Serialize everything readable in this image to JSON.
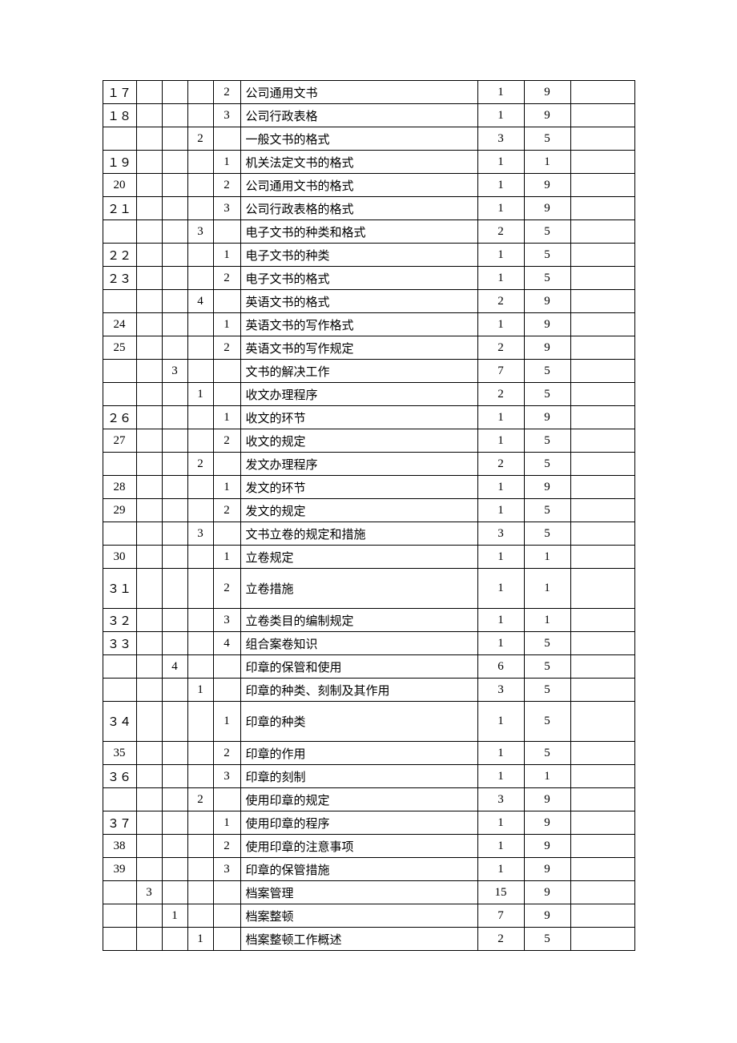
{
  "chart_data": {
    "type": "table",
    "rows": [
      {
        "c0": "１７",
        "c1": "",
        "c2": "",
        "c3": "",
        "c4": "2",
        "c5": "公司通用文书",
        "c6": "1",
        "c7": "9",
        "c8": ""
      },
      {
        "c0": "１８",
        "c1": "",
        "c2": "",
        "c3": "",
        "c4": "3",
        "c5": "公司行政表格",
        "c6": "1",
        "c7": "9",
        "c8": ""
      },
      {
        "c0": "",
        "c1": "",
        "c2": "",
        "c3": "2",
        "c4": "",
        "c5": "一般文书的格式",
        "c6": "3",
        "c7": "5",
        "c8": ""
      },
      {
        "c0": "１９",
        "c1": "",
        "c2": "",
        "c3": "",
        "c4": "1",
        "c5": "机关法定文书的格式",
        "c6": "1",
        "c7": "1",
        "c8": ""
      },
      {
        "c0": "20",
        "c1": "",
        "c2": "",
        "c3": "",
        "c4": "2",
        "c5": "公司通用文书的格式",
        "c6": "1",
        "c7": "9",
        "c8": ""
      },
      {
        "c0": "２１",
        "c1": "",
        "c2": "",
        "c3": "",
        "c4": "3",
        "c5": "公司行政表格的格式",
        "c6": "1",
        "c7": "9",
        "c8": ""
      },
      {
        "c0": "",
        "c1": "",
        "c2": "",
        "c3": "3",
        "c4": "",
        "c5": "电子文书的种类和格式",
        "c6": "2",
        "c7": "5",
        "c8": ""
      },
      {
        "c0": "２２",
        "c1": "",
        "c2": "",
        "c3": "",
        "c4": "1",
        "c5": "电子文书的种类",
        "c6": "1",
        "c7": "5",
        "c8": ""
      },
      {
        "c0": "２３",
        "c1": "",
        "c2": "",
        "c3": "",
        "c4": "2",
        "c5": "电子文书的格式",
        "c6": "1",
        "c7": "5",
        "c8": ""
      },
      {
        "c0": "",
        "c1": "",
        "c2": "",
        "c3": "4",
        "c4": "",
        "c5": "英语文书的格式",
        "c6": "2",
        "c7": "9",
        "c8": ""
      },
      {
        "c0": "24",
        "c1": "",
        "c2": "",
        "c3": "",
        "c4": "1",
        "c5": "英语文书的写作格式",
        "c6": "1",
        "c7": "9",
        "c8": ""
      },
      {
        "c0": "25",
        "c1": "",
        "c2": "",
        "c3": "",
        "c4": "2",
        "c5": "英语文书的写作规定",
        "c6": "2",
        "c7": "9",
        "c8": ""
      },
      {
        "c0": "",
        "c1": "",
        "c2": "3",
        "c3": "",
        "c4": "",
        "c5": "文书的解决工作",
        "c6": "7",
        "c7": "5",
        "c8": ""
      },
      {
        "c0": "",
        "c1": "",
        "c2": "",
        "c3": "1",
        "c4": "",
        "c5": "收文办理程序",
        "c6": "2",
        "c7": "5",
        "c8": ""
      },
      {
        "c0": "２６",
        "c1": "",
        "c2": "",
        "c3": "",
        "c4": "1",
        "c5": "收文的环节",
        "c6": "1",
        "c7": "9",
        "c8": ""
      },
      {
        "c0": "27",
        "c1": "",
        "c2": "",
        "c3": "",
        "c4": "2",
        "c5": "收文的规定",
        "c6": "1",
        "c7": "5",
        "c8": ""
      },
      {
        "c0": "",
        "c1": "",
        "c2": "",
        "c3": "2",
        "c4": "",
        "c5": "发文办理程序",
        "c6": "2",
        "c7": "5",
        "c8": ""
      },
      {
        "c0": "28",
        "c1": "",
        "c2": "",
        "c3": "",
        "c4": "1",
        "c5": "发文的环节",
        "c6": "1",
        "c7": "9",
        "c8": ""
      },
      {
        "c0": "29",
        "c1": "",
        "c2": "",
        "c3": "",
        "c4": "2",
        "c5": "发文的规定",
        "c6": "1",
        "c7": "5",
        "c8": ""
      },
      {
        "c0": "",
        "c1": "",
        "c2": "",
        "c3": "3",
        "c4": "",
        "c5": "文书立卷的规定和措施",
        "c6": "3",
        "c7": "5",
        "c8": ""
      },
      {
        "c0": "30",
        "c1": "",
        "c2": "",
        "c3": "",
        "c4": "1",
        "c5": "立卷规定",
        "c6": "1",
        "c7": "1",
        "c8": ""
      },
      {
        "c0": "３１",
        "c1": "",
        "c2": "",
        "c3": "",
        "c4": "2",
        "c5": "立卷措施",
        "c6": "1",
        "c7": "1",
        "c8": "",
        "tall": true
      },
      {
        "c0": "３２",
        "c1": "",
        "c2": "",
        "c3": "",
        "c4": "3",
        "c5": "立卷类目的编制规定",
        "c6": "1",
        "c7": "1",
        "c8": ""
      },
      {
        "c0": "３３",
        "c1": "",
        "c2": "",
        "c3": "",
        "c4": "4",
        "c5": "组合案卷知识",
        "c6": "1",
        "c7": "5",
        "c8": ""
      },
      {
        "c0": "",
        "c1": "",
        "c2": "4",
        "c3": "",
        "c4": "",
        "c5": "印章的保管和使用",
        "c6": "6",
        "c7": "5",
        "c8": ""
      },
      {
        "c0": "",
        "c1": "",
        "c2": "",
        "c3": "1",
        "c4": "",
        "c5": "印章的种类、刻制及其作用",
        "c6": "3",
        "c7": "5",
        "c8": ""
      },
      {
        "c0": "３４",
        "c1": "",
        "c2": "",
        "c3": "",
        "c4": "1",
        "c5": "印章的种类",
        "c6": "1",
        "c7": "5",
        "c8": "",
        "tall": true
      },
      {
        "c0": "35",
        "c1": "",
        "c2": "",
        "c3": "",
        "c4": "2",
        "c5": "印章的作用",
        "c6": "1",
        "c7": "5",
        "c8": ""
      },
      {
        "c0": "３６",
        "c1": "",
        "c2": "",
        "c3": "",
        "c4": "3",
        "c5": "印章的刻制",
        "c6": "1",
        "c7": "1",
        "c8": ""
      },
      {
        "c0": "",
        "c1": "",
        "c2": "",
        "c3": "2",
        "c4": "",
        "c5": "使用印章的规定",
        "c6": "3",
        "c7": "9",
        "c8": ""
      },
      {
        "c0": "３７",
        "c1": "",
        "c2": "",
        "c3": "",
        "c4": "1",
        "c5": "使用印章的程序",
        "c6": "1",
        "c7": "9",
        "c8": ""
      },
      {
        "c0": "38",
        "c1": "",
        "c2": "",
        "c3": "",
        "c4": "2",
        "c5": "使用印章的注意事项",
        "c6": "1",
        "c7": "9",
        "c8": ""
      },
      {
        "c0": "39",
        "c1": "",
        "c2": "",
        "c3": "",
        "c4": "3",
        "c5": "印章的保管措施",
        "c6": "1",
        "c7": "9",
        "c8": ""
      },
      {
        "c0": "",
        "c1": "3",
        "c2": "",
        "c3": "",
        "c4": "",
        "c5": "档案管理",
        "c6": "15",
        "c7": "9",
        "c8": ""
      },
      {
        "c0": "",
        "c1": "",
        "c2": "1",
        "c3": "",
        "c4": "",
        "c5": "档案整顿",
        "c6": "7",
        "c7": "9",
        "c8": ""
      },
      {
        "c0": "",
        "c1": "",
        "c2": "",
        "c3": "1",
        "c4": "",
        "c5": "档案整顿工作概述",
        "c6": "2",
        "c7": "5",
        "c8": ""
      }
    ]
  }
}
